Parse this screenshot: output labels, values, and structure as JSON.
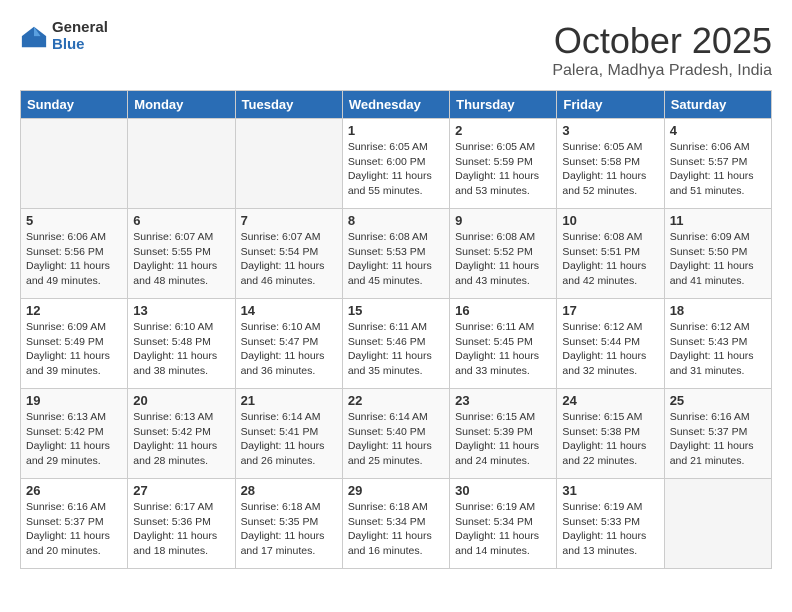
{
  "header": {
    "logo_general": "General",
    "logo_blue": "Blue",
    "month": "October 2025",
    "location": "Palera, Madhya Pradesh, India"
  },
  "weekdays": [
    "Sunday",
    "Monday",
    "Tuesday",
    "Wednesday",
    "Thursday",
    "Friday",
    "Saturday"
  ],
  "weeks": [
    [
      {
        "day": "",
        "empty": true
      },
      {
        "day": "",
        "empty": true
      },
      {
        "day": "",
        "empty": true
      },
      {
        "day": "1",
        "sunrise": "6:05 AM",
        "sunset": "6:00 PM",
        "daylight": "11 hours and 55 minutes."
      },
      {
        "day": "2",
        "sunrise": "6:05 AM",
        "sunset": "5:59 PM",
        "daylight": "11 hours and 53 minutes."
      },
      {
        "day": "3",
        "sunrise": "6:05 AM",
        "sunset": "5:58 PM",
        "daylight": "11 hours and 52 minutes."
      },
      {
        "day": "4",
        "sunrise": "6:06 AM",
        "sunset": "5:57 PM",
        "daylight": "11 hours and 51 minutes."
      }
    ],
    [
      {
        "day": "5",
        "sunrise": "6:06 AM",
        "sunset": "5:56 PM",
        "daylight": "11 hours and 49 minutes."
      },
      {
        "day": "6",
        "sunrise": "6:07 AM",
        "sunset": "5:55 PM",
        "daylight": "11 hours and 48 minutes."
      },
      {
        "day": "7",
        "sunrise": "6:07 AM",
        "sunset": "5:54 PM",
        "daylight": "11 hours and 46 minutes."
      },
      {
        "day": "8",
        "sunrise": "6:08 AM",
        "sunset": "5:53 PM",
        "daylight": "11 hours and 45 minutes."
      },
      {
        "day": "9",
        "sunrise": "6:08 AM",
        "sunset": "5:52 PM",
        "daylight": "11 hours and 43 minutes."
      },
      {
        "day": "10",
        "sunrise": "6:08 AM",
        "sunset": "5:51 PM",
        "daylight": "11 hours and 42 minutes."
      },
      {
        "day": "11",
        "sunrise": "6:09 AM",
        "sunset": "5:50 PM",
        "daylight": "11 hours and 41 minutes."
      }
    ],
    [
      {
        "day": "12",
        "sunrise": "6:09 AM",
        "sunset": "5:49 PM",
        "daylight": "11 hours and 39 minutes."
      },
      {
        "day": "13",
        "sunrise": "6:10 AM",
        "sunset": "5:48 PM",
        "daylight": "11 hours and 38 minutes."
      },
      {
        "day": "14",
        "sunrise": "6:10 AM",
        "sunset": "5:47 PM",
        "daylight": "11 hours and 36 minutes."
      },
      {
        "day": "15",
        "sunrise": "6:11 AM",
        "sunset": "5:46 PM",
        "daylight": "11 hours and 35 minutes."
      },
      {
        "day": "16",
        "sunrise": "6:11 AM",
        "sunset": "5:45 PM",
        "daylight": "11 hours and 33 minutes."
      },
      {
        "day": "17",
        "sunrise": "6:12 AM",
        "sunset": "5:44 PM",
        "daylight": "11 hours and 32 minutes."
      },
      {
        "day": "18",
        "sunrise": "6:12 AM",
        "sunset": "5:43 PM",
        "daylight": "11 hours and 31 minutes."
      }
    ],
    [
      {
        "day": "19",
        "sunrise": "6:13 AM",
        "sunset": "5:42 PM",
        "daylight": "11 hours and 29 minutes."
      },
      {
        "day": "20",
        "sunrise": "6:13 AM",
        "sunset": "5:42 PM",
        "daylight": "11 hours and 28 minutes."
      },
      {
        "day": "21",
        "sunrise": "6:14 AM",
        "sunset": "5:41 PM",
        "daylight": "11 hours and 26 minutes."
      },
      {
        "day": "22",
        "sunrise": "6:14 AM",
        "sunset": "5:40 PM",
        "daylight": "11 hours and 25 minutes."
      },
      {
        "day": "23",
        "sunrise": "6:15 AM",
        "sunset": "5:39 PM",
        "daylight": "11 hours and 24 minutes."
      },
      {
        "day": "24",
        "sunrise": "6:15 AM",
        "sunset": "5:38 PM",
        "daylight": "11 hours and 22 minutes."
      },
      {
        "day": "25",
        "sunrise": "6:16 AM",
        "sunset": "5:37 PM",
        "daylight": "11 hours and 21 minutes."
      }
    ],
    [
      {
        "day": "26",
        "sunrise": "6:16 AM",
        "sunset": "5:37 PM",
        "daylight": "11 hours and 20 minutes."
      },
      {
        "day": "27",
        "sunrise": "6:17 AM",
        "sunset": "5:36 PM",
        "daylight": "11 hours and 18 minutes."
      },
      {
        "day": "28",
        "sunrise": "6:18 AM",
        "sunset": "5:35 PM",
        "daylight": "11 hours and 17 minutes."
      },
      {
        "day": "29",
        "sunrise": "6:18 AM",
        "sunset": "5:34 PM",
        "daylight": "11 hours and 16 minutes."
      },
      {
        "day": "30",
        "sunrise": "6:19 AM",
        "sunset": "5:34 PM",
        "daylight": "11 hours and 14 minutes."
      },
      {
        "day": "31",
        "sunrise": "6:19 AM",
        "sunset": "5:33 PM",
        "daylight": "11 hours and 13 minutes."
      },
      {
        "day": "",
        "empty": true
      }
    ]
  ]
}
